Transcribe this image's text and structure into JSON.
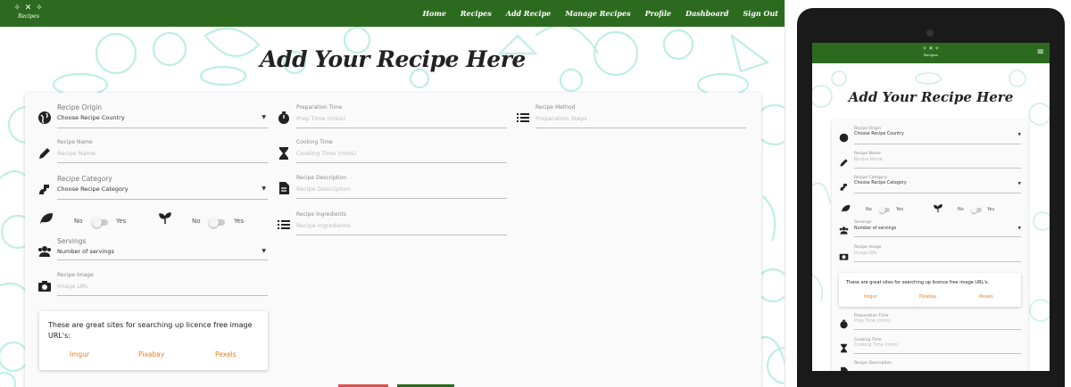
{
  "colors": {
    "nav": "#2c6b1f",
    "link": "#e67e22",
    "cancel": "#d9534f",
    "submit": "#2c6b1f"
  },
  "logo": {
    "mark": "✧ ✕ ✧",
    "text": "Recipes"
  },
  "nav": [
    "Home",
    "Recipes",
    "Add Recipe",
    "Manage Recipes",
    "Profile",
    "Dashboard",
    "Sign Out"
  ],
  "title": "Add Your Recipe Here",
  "form": {
    "recipe_origin": {
      "label": "Recipe Origin",
      "value": "Choose Recipe Country"
    },
    "recipe_name": {
      "label": "Recipe Name",
      "placeholder": "Recipe Name"
    },
    "recipe_category": {
      "label": "Recipe Category",
      "value": "Choose Recipe Category"
    },
    "vegan_toggle": {
      "off": "No",
      "on": "Yes"
    },
    "vegetarian_toggle": {
      "off": "No",
      "on": "Yes"
    },
    "servings": {
      "label": "Servings",
      "value": "Number of servings"
    },
    "recipe_image": {
      "label": "Recipe Image",
      "placeholder": "Image URL"
    },
    "prep_time": {
      "label": "Preparation Time",
      "placeholder": "Prep Time (mins)"
    },
    "cooking_time": {
      "label": "Cooking Time",
      "placeholder": "Cooking Time (mins)"
    },
    "description": {
      "label": "Recipe Description",
      "placeholder": "Recipe Description"
    },
    "ingredients": {
      "label": "Recipe Ingredients",
      "placeholder": "Recipe Ingredients"
    },
    "method": {
      "label": "Recipe Method",
      "placeholder": "Preparation Steps"
    }
  },
  "info": {
    "message": "These are great sites for searching up licence free image URL's:",
    "links": [
      "Imgur",
      "Pixabay",
      "Pexels"
    ]
  },
  "tablet": {
    "menu_icon": "≡",
    "form": {
      "recipe_origin": {
        "label": "Recipe Origin",
        "value": "Choose Recipe Country"
      },
      "recipe_name": {
        "label": "Recipe Name",
        "placeholder": "Recipe Name"
      },
      "recipe_category": {
        "label": "Recipe Category",
        "value": "Choose Recipe Category"
      },
      "servings": {
        "label": "Servings",
        "value": "Number of servings"
      },
      "recipe_image": {
        "label": "Recipe Image",
        "placeholder": "Image URL"
      },
      "prep_time": {
        "label": "Preparation Time",
        "placeholder": "Prep Time (mins)"
      },
      "cooking_time": {
        "label": "Cooking Time",
        "placeholder": "Cooking Time (mins)"
      },
      "description": {
        "label": "Recipe Description"
      }
    }
  }
}
